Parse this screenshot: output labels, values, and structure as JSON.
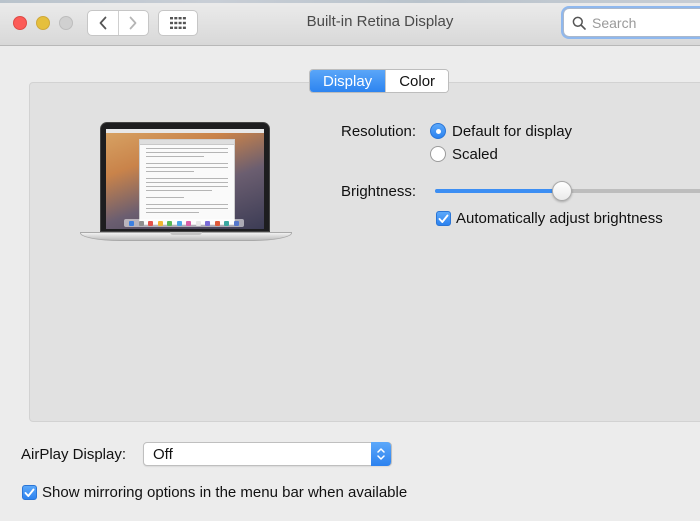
{
  "window": {
    "title": "Built-in Retina Display"
  },
  "toolbar": {
    "search_placeholder": "Search"
  },
  "tabs": [
    {
      "label": "Display",
      "active": true
    },
    {
      "label": "Color",
      "active": false
    }
  ],
  "resolution": {
    "label": "Resolution:",
    "options": [
      {
        "label": "Default for display",
        "selected": true
      },
      {
        "label": "Scaled",
        "selected": false
      }
    ]
  },
  "brightness": {
    "label": "Brightness:",
    "value": 0.48,
    "auto_adjust_label": "Automatically adjust brightness",
    "auto_adjust_checked": true
  },
  "airplay": {
    "label": "AirPlay Display:",
    "selected": "Off"
  },
  "mirroring": {
    "label": "Show mirroring options in the menu bar when available",
    "checked": true
  },
  "colors": {
    "accent": "#2d84f0",
    "close": "#fc5b57",
    "minimize": "#e5bf3c",
    "zoom_disabled": "#d0d0d0"
  },
  "icons": [
    "back-chevron-icon",
    "forward-chevron-icon",
    "show-all-grid-icon",
    "search-icon",
    "checkmark-icon",
    "popup-arrows-icon"
  ]
}
